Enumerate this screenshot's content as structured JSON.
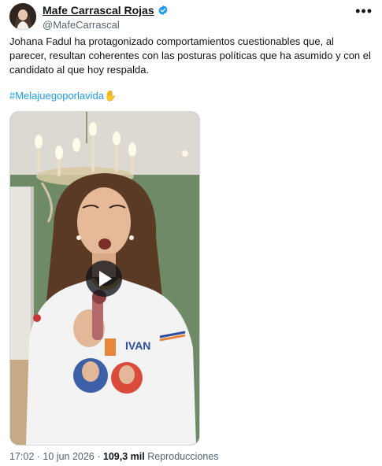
{
  "author": {
    "display_name": "Mafe Carrascal Rojas",
    "handle": "@MafeCarrascal",
    "verified": true,
    "verified_color": "#1d9bf0"
  },
  "tweet": {
    "text": "Johana Fadul ha protagonizado comportamientos cuestionables que, al parecer, resultan coherentes con las posturas políticas que ha asumido y con el candidato al que hoy respalda.",
    "hashtag": "#Melajuegoporlavida",
    "hashtag_emoji": "✋"
  },
  "meta": {
    "time": "17:02",
    "separator_1": "·",
    "date": "10 jun 2026",
    "separator_2": "·",
    "views": "109,3 mil",
    "views_label": "Reproducciones"
  },
  "icons": {
    "more": "more-options-icon",
    "play": "play-icon",
    "verified": "verified-badge-icon"
  },
  "colors": {
    "link": "#1d9bf0",
    "secondary_text": "#536471",
    "primary_text": "#0f1419"
  }
}
